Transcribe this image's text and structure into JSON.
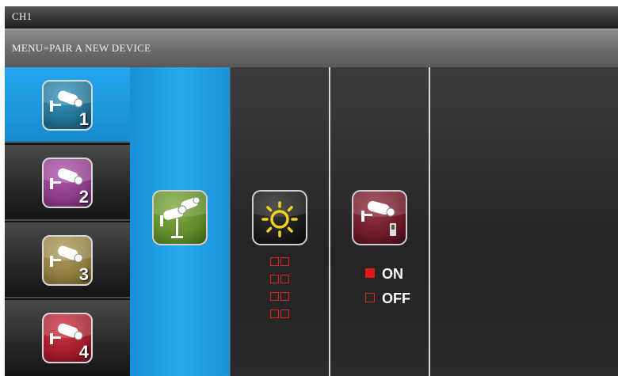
{
  "title_bar": {
    "text": "CH1"
  },
  "menu_bar": {
    "text": "MENU=PAIR A NEW DEVICE"
  },
  "channels": [
    {
      "number": "1",
      "color": "#1f6d8f",
      "selected": true
    },
    {
      "number": "2",
      "color": "#8a3a86",
      "selected": false
    },
    {
      "number": "3",
      "color": "#8d7a3e",
      "selected": false
    },
    {
      "number": "4",
      "color": "#a11a2a",
      "selected": false
    }
  ],
  "options": {
    "pair_device": {
      "icon": "add-cameras-icon",
      "color": "#5f8a2a"
    },
    "brightness": {
      "icon": "sun-icon",
      "levels": 4,
      "color": "#1a1a1a"
    },
    "alarm": {
      "icon": "camera-switch-icon",
      "color": "#6a1a28",
      "on_label": "ON",
      "off_label": "OFF",
      "selected": "ON"
    }
  },
  "colors": {
    "selection_blue": "#1c97dd",
    "indicator_red": "#e01818"
  }
}
